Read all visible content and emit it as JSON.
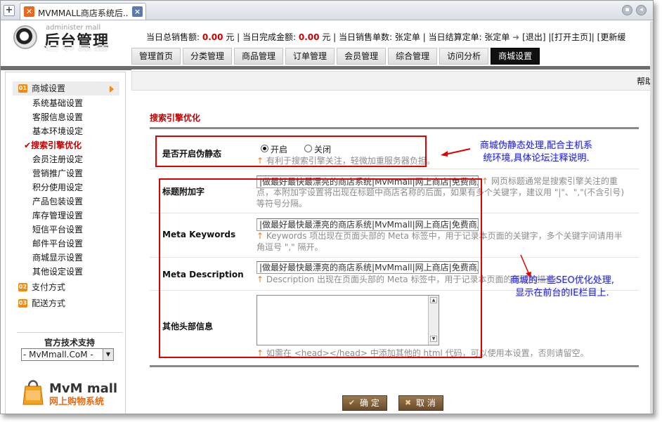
{
  "browser": {
    "tab_title": "MVMMALL商店系统后...",
    "new_tab_symbol": "+",
    "close_symbol": "×"
  },
  "header": {
    "logo_subtitle": "administer mall",
    "logo_title": "后台管理",
    "stats": {
      "sales_label": "当日总销售额:",
      "sales_value": "0.00",
      "sales_unit": "元",
      "done_label": "| 当日完成金额:",
      "done_value": "0.00",
      "done_unit": "元",
      "order_label": "| 当日销售单数: 张定单",
      "settled_label": "| 当日结算定单: 张定单",
      "logout": "[退出]",
      "open_home": "|[打开主页]|",
      "update_cache": "[更新缓"
    },
    "nav_tabs": [
      "管理首页",
      "分类管理",
      "商品管理",
      "订单管理",
      "会员管理",
      "综合管理",
      "访问分析",
      "商城设置"
    ],
    "active_tab": "商城设置"
  },
  "sidebar": {
    "section1": {
      "num": "01",
      "label": "商城设置"
    },
    "items": [
      "系统基础设置",
      "客服信息设置",
      "基本环境设定",
      "搜索引擎优化",
      "会员注册设定",
      "营销推广设置",
      "积分使用设定",
      "产品包装设置",
      "库存管理设置",
      "短信平台设置",
      "邮件平台设置",
      "商城显示设置",
      "其他设定设置"
    ],
    "active_item": "搜索引擎优化",
    "active_mark": "✔",
    "section2": {
      "num": "02",
      "label": "支付方式"
    },
    "section3": {
      "num": "03",
      "label": "配送方式"
    },
    "support_title": "官方技术支持",
    "support_select": "- MvMmall.CoM -",
    "brand_name": "MvM mall",
    "brand_sub": "网上购物系统"
  },
  "main": {
    "help": "帮助",
    "page_title": "搜索引擎优化",
    "static": {
      "label": "是否开启伪静态",
      "on": "开启",
      "off": "关闭",
      "hint": "有利于搜索引擎关注，轻微加重服务器负担。"
    },
    "title_suffix": {
      "label": "标题附加字",
      "value": "|做最好最快最漂亮的商店系统|MvMmall|网上商店|免费商店",
      "hint_a": "网页标题通常是搜索引擎关注的重",
      "hint_b": "点，本附加字设置将出现在标题中商店名称的后面，如果有多个关键字，建议用 \"|\"、\",\"(不含引号)",
      "hint_c": "等符号分隔。"
    },
    "keywords": {
      "label": "Meta Keywords",
      "value": "|做最好最快最漂亮的商店系统|MvMmall|网上商店|免费商店",
      "hint_a": "Keywords 项出现在页面头部的  Meta 标签中，用于记录本页面的关键字，多个关键字间请用半",
      "hint_b": "角逗号 \",\" 隔开。"
    },
    "description": {
      "label": "Meta Description",
      "value": "|做最好最快最漂亮的商店系统|MvMmall|网上商店|免费商店",
      "hint": "Description 出现在页面头部的  Meta 标签中，用于记录本页面的概要与描述。"
    },
    "other_head": {
      "label": "其他头部信息",
      "hint": "如需在  <head></head> 中添加其他的  html 代码，可以使用本设置，否则请留空。"
    },
    "hint_arrow": "↑",
    "confirm": "确 定",
    "cancel": "取 消",
    "confirm_icon": "✔",
    "cancel_icon": "✖"
  },
  "annotations": {
    "note1_a": "商城伪静态处理,配合主机系",
    "note1_b": "统环境,具体论坛注释说明.",
    "note2_a": "商城的一些SEO优化处理,",
    "note2_b": "显示在前台的IE栏目上."
  },
  "colors": {
    "accent_red": "#c00000",
    "highlight_red": "#e00000",
    "note_blue": "#2a2ad2",
    "orange": "#f08a10",
    "nav_active": "#111111"
  }
}
